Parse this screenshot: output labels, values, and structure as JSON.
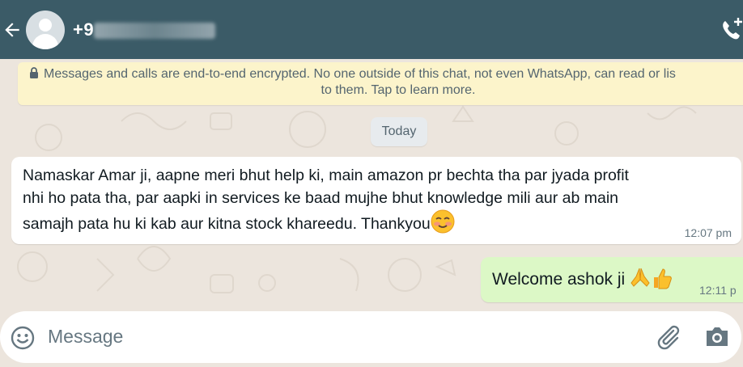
{
  "header": {
    "contact_prefix": "+9",
    "back_icon": "arrow-left-icon",
    "avatar_icon": "default-avatar-icon",
    "call_icon": "call-add-icon",
    "colors": {
      "bar": "#3b5b67"
    }
  },
  "banner": {
    "line1": "Messages and calls are end-to-end encrypted. No one outside of this chat, not even WhatsApp, can read or lis",
    "line2": "to them. Tap to learn more.",
    "icon": "lock-icon"
  },
  "date_chip": "Today",
  "messages": [
    {
      "direction": "incoming",
      "line1": "Namaskar Amar ji, aapne meri bhut help ki, main amazon pr bechta tha par jyada profit",
      "line2": "nhi ho pata tha, par aapki in services ke baad mujhe bhut knowledge mili aur ab main",
      "line3": "samajh pata hu ki kab aur kitna stock khareedu. Thankyou",
      "emoji": "smiling-blush-emoji",
      "time": "12:07 pm"
    },
    {
      "direction": "outgoing",
      "text": "Welcome ashok ji",
      "emoji": [
        "folded-hands-emoji",
        "thumbs-up-emoji"
      ],
      "time": "12:11 p"
    }
  ],
  "composer": {
    "placeholder": "Message",
    "emoji_icon": "smiley-icon",
    "attach_icon": "paperclip-icon",
    "camera_icon": "camera-icon"
  }
}
